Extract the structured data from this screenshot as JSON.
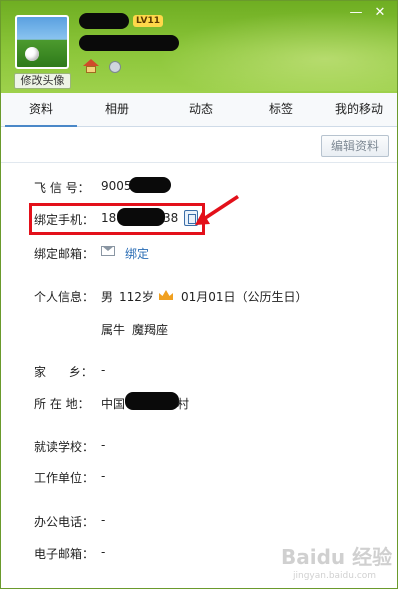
{
  "window": {
    "minimize_glyph": "—",
    "close_glyph": "✕"
  },
  "header": {
    "level_badge": "LV11",
    "change_avatar_label": "修改头像"
  },
  "tabs": [
    {
      "label": "资料",
      "active": true
    },
    {
      "label": "相册",
      "active": false
    },
    {
      "label": "动态",
      "active": false
    },
    {
      "label": "标签",
      "active": false
    },
    {
      "label": "我的移动",
      "active": false
    }
  ],
  "toolbar": {
    "edit_profile_label": "编辑资料"
  },
  "profile": {
    "fetion_label": "飞 信 号：",
    "fetion_value": "9005",
    "bind_phone_label": "绑定手机：",
    "bind_phone_prefix": "18",
    "bind_phone_suffix": "38",
    "bind_email_label": "绑定邮箱：",
    "bind_email_link": "绑定",
    "personal_label": "个人信息：",
    "gender": "男",
    "age": "112岁",
    "birthday": "01月01日（公历生日）",
    "zodiac": "属牛",
    "constellation": "魔羯座",
    "hometown_label": "家      乡：",
    "hometown_value": "-",
    "location_label": "所 在 地：",
    "location_value_prefix": "中国",
    "location_value_suffix": "村",
    "school_label": "就读学校：",
    "school_value": "-",
    "work_label": "工作单位：",
    "work_value": "-",
    "office_phone_label": "办公电话：",
    "office_phone_value": "-",
    "email_label": "电子邮箱：",
    "email_value": "-"
  },
  "watermark": {
    "text": "Baidu 经验",
    "sub": "jingyan.baidu.com"
  },
  "colors": {
    "header_green": "#8cc63a",
    "highlight_red": "#e3101a",
    "link_blue": "#2a6db5",
    "tab_underline": "#4a88c8"
  }
}
